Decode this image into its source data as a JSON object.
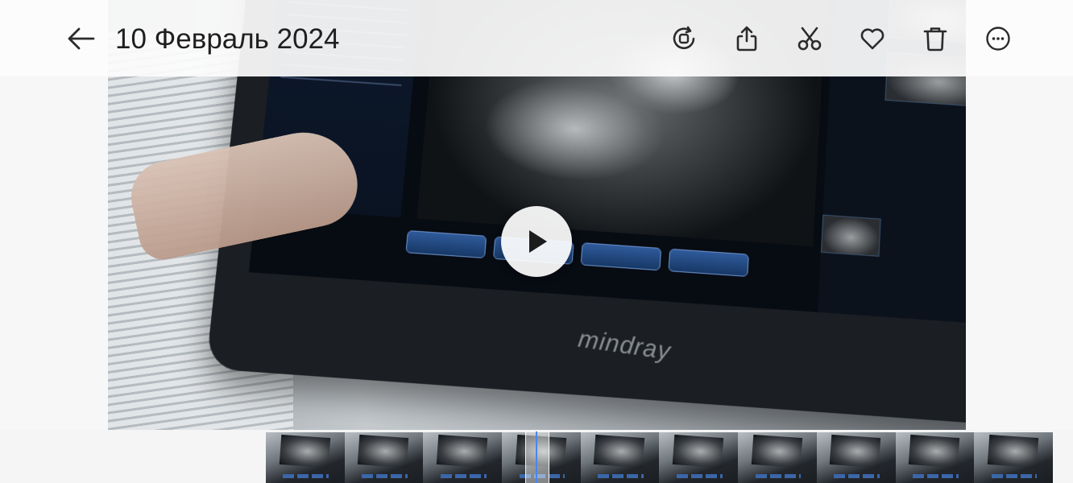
{
  "header": {
    "title": "10 Февраль 2024",
    "back_icon": "arrow-left-icon"
  },
  "actions": [
    {
      "name": "rotate-video-icon"
    },
    {
      "name": "share-icon"
    },
    {
      "name": "cut-icon"
    },
    {
      "name": "favorite-icon"
    },
    {
      "name": "delete-icon"
    },
    {
      "name": "more-icon"
    }
  ],
  "video": {
    "brand": "mindray"
  },
  "filmstrip": {
    "frame_count": 10,
    "playhead_fraction": 0.34
  },
  "colors": {
    "accent": "#4a86e8",
    "icon": "#2b2b2b",
    "topbar": "#fcfcfc"
  }
}
